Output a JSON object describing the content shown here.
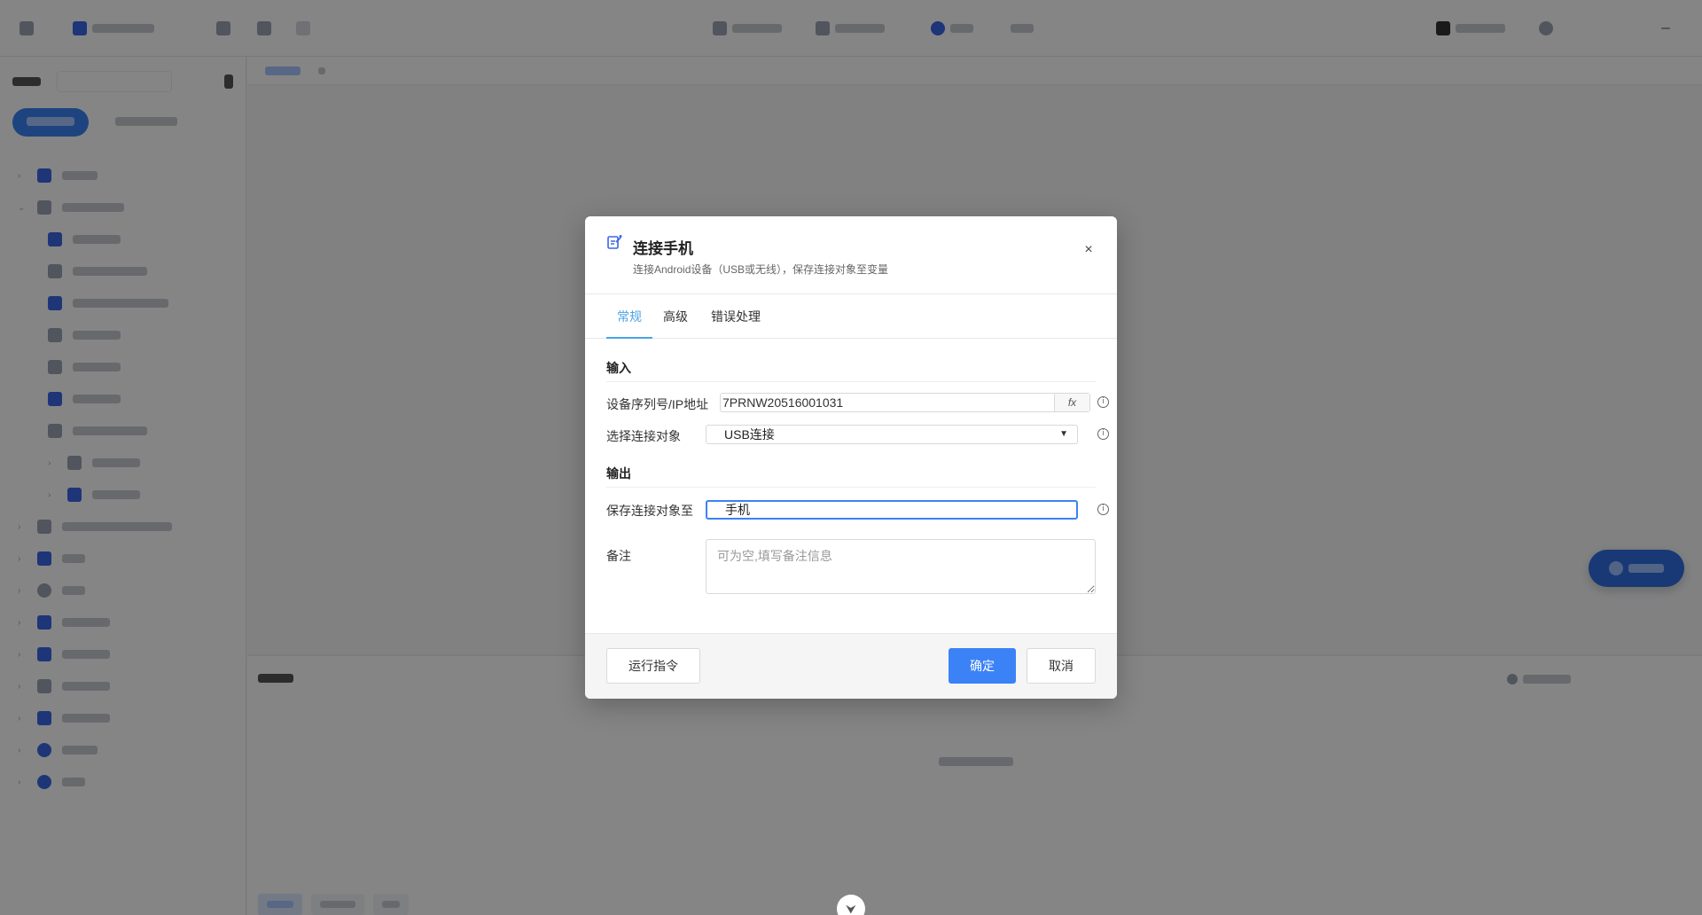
{
  "dialog": {
    "title": "连接手机",
    "subtitle": "连接Android设备（USB或无线），保存连接对象至变量",
    "close_glyph": "×",
    "tabs": [
      {
        "label": "常规",
        "active": true
      },
      {
        "label": "高级",
        "active": false
      },
      {
        "label": "错误处理",
        "active": false
      }
    ],
    "input_section": {
      "title": "输入",
      "fields": [
        {
          "label": "设备序列号/IP地址",
          "value": "7PRNW20516001031",
          "fx_label": "fx"
        },
        {
          "label": "选择连接对象",
          "value": "USB连接"
        }
      ]
    },
    "output_section": {
      "title": "输出",
      "fields": [
        {
          "label": "保存连接对象至",
          "value": "手机"
        }
      ]
    },
    "remark": {
      "label": "备注",
      "placeholder": "可为空,填写备注信息"
    },
    "footer": {
      "run_label": "运行指令",
      "confirm_label": "确定",
      "cancel_label": "取消"
    }
  },
  "colors": {
    "accent": "#3b82f6",
    "tab_active": "#4ba3e3",
    "overlay": "rgba(0,0,0,0.48)"
  },
  "icons": {
    "dialog_icon": "edit-device-icon",
    "close": "close-icon",
    "info": "info-icon",
    "dropdown": "caret-down-icon",
    "collapse": "chevron-down-icon"
  }
}
